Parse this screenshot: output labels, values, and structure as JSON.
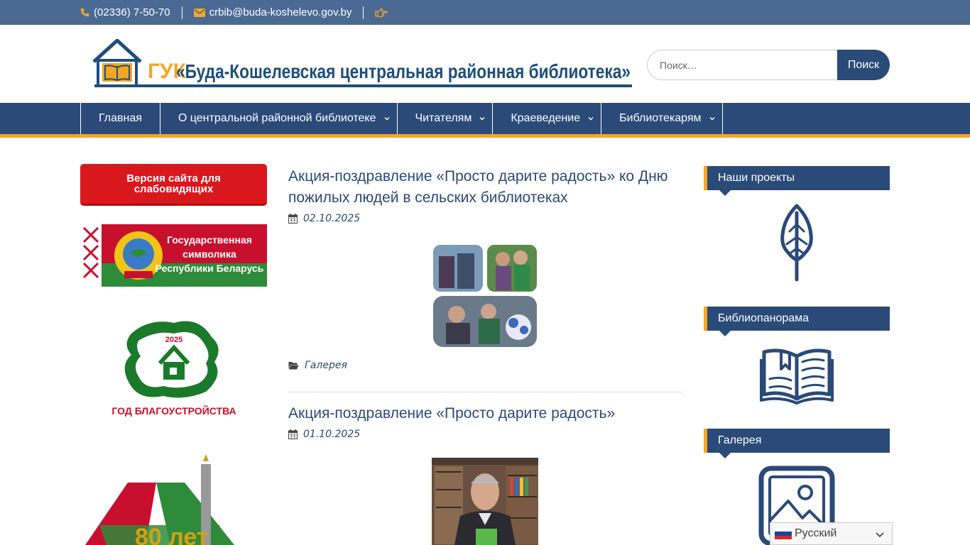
{
  "topbar": {
    "phone": "(02336) 7-50-70",
    "email": "crbib@buda-koshelevo.gov.by",
    "icons": [
      "phone-icon",
      "envelope-icon",
      "hand-pointer-icon"
    ]
  },
  "header": {
    "logo_prefix": "ГУК",
    "logo_text": "«Буда-Кошелевская центральная районная библиотека»",
    "search_placeholder": "Поиск…",
    "search_button": "Поиск"
  },
  "nav": {
    "items": [
      {
        "label": "Главная",
        "has_dropdown": false
      },
      {
        "label": "О центральной районной библиотеке",
        "has_dropdown": true
      },
      {
        "label": "Читателям",
        "has_dropdown": true
      },
      {
        "label": "Краеведение",
        "has_dropdown": true
      },
      {
        "label": "Библиотекарям",
        "has_dropdown": true
      }
    ]
  },
  "left_sidebar": {
    "impaired_button": "Версия сайта для слабовидящих",
    "symbols_banner": {
      "line1": "Государственная",
      "line2": "символика",
      "line3": "Республики Беларусь"
    },
    "year_banner": {
      "year": "2025",
      "caption": "ГОД БЛАГОУСТРОЙСТВА"
    },
    "anniversary_banner": {
      "text": "80 лет"
    }
  },
  "posts": [
    {
      "title": "Акция-поздравление «Просто дарите радость» ко Дню пожилых людей в сельских библиотеках",
      "date": "02.10.2025",
      "category": "Галерея"
    },
    {
      "title": "Акция-поздравление «Просто дарите радость»",
      "date": "01.10.2025"
    }
  ],
  "right_sidebar": {
    "widgets": [
      {
        "title": "Наши проекты",
        "icon": "feather-icon"
      },
      {
        "title": "Библиопанорама",
        "icon": "open-book-icon"
      },
      {
        "title": "Галерея",
        "icon": "image-icon"
      }
    ]
  },
  "language": {
    "selected": "Русский"
  },
  "colors": {
    "primary": "#2a4a78",
    "topbar": "#4a6a93",
    "accent": "#f5a623",
    "alert": "#d9181e"
  }
}
